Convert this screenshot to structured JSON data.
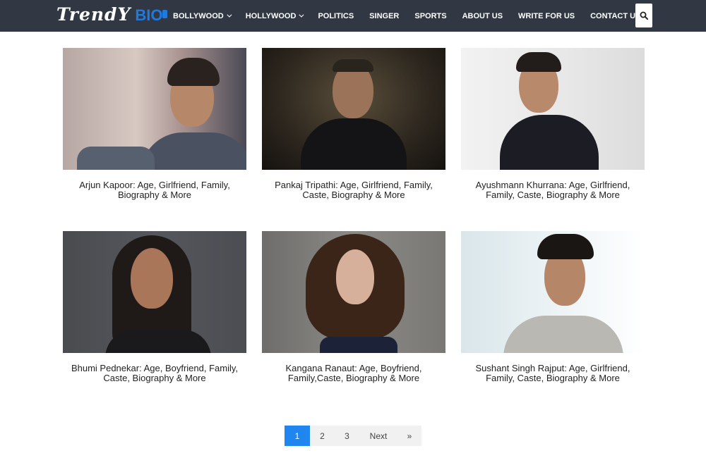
{
  "header": {
    "logo_text_1": "TrendY",
    "logo_text_2": "BIO",
    "nav": [
      {
        "label": "BOLLYWOOD",
        "dropdown": true
      },
      {
        "label": "HOLLYWOOD",
        "dropdown": true
      },
      {
        "label": "POLITICS",
        "dropdown": false
      },
      {
        "label": "SINGER",
        "dropdown": false
      },
      {
        "label": "SPORTS",
        "dropdown": false
      },
      {
        "label": "ABOUT US",
        "dropdown": false
      },
      {
        "label": "WRITE FOR US",
        "dropdown": false
      },
      {
        "label": "CONTACT US",
        "dropdown": false
      }
    ],
    "search_icon": "search-icon"
  },
  "posts": [
    {
      "title": "Arjun Kapoor: Age, Girlfriend, Family, Biography & More"
    },
    {
      "title": "Pankaj Tripathi: Age, Girlfriend, Family, Caste, Biography & More"
    },
    {
      "title": "Ayushmann Khurrana: Age, Girlfriend, Family, Caste, Biography & More"
    },
    {
      "title": "Bhumi Pednekar: Age, Boyfriend, Family, Caste, Biography & More"
    },
    {
      "title": "Kangana Ranaut: Age, Boyfriend, Family,Caste, Biography & More"
    },
    {
      "title": "Sushant Singh Rajput: Age, Girlfriend, Family, Caste, Biography & More"
    }
  ],
  "pagination": {
    "pages": [
      "1",
      "2",
      "3"
    ],
    "current": "1",
    "next_label": "Next",
    "last_label": "»"
  },
  "colors": {
    "header_bg": "#313843",
    "accent": "#1f86f0",
    "logo_blue": "#1f7ae0"
  }
}
